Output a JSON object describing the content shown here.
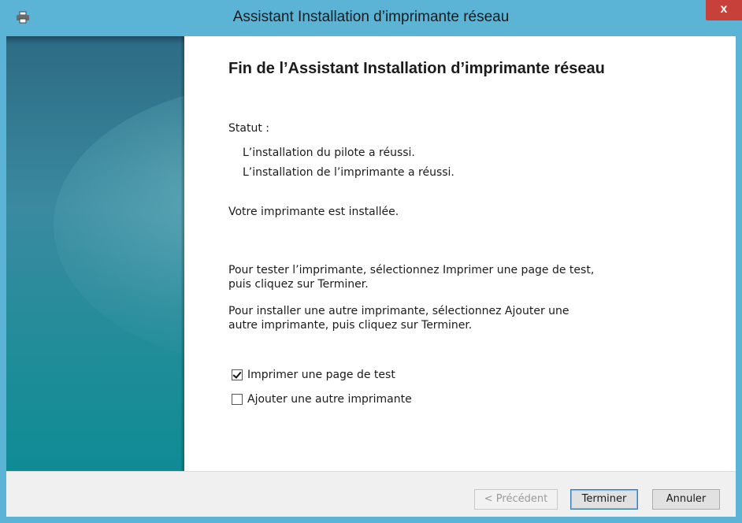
{
  "window": {
    "title": "Assistant Installation d’imprimante réseau",
    "close_label": "x",
    "title_icon": "printer-icon",
    "accent_color": "#5bb4d6",
    "close_color": "#c7413a"
  },
  "main": {
    "heading": "Fin de l’Assistant Installation d’imprimante réseau",
    "status_label": "Statut :",
    "status_lines": [
      "L’installation du pilote a réussi.",
      "L’installation de l’imprimante a réussi."
    ],
    "installed_message": "Votre imprimante est installée.",
    "test_instructions": [
      "Pour tester l’imprimante, sélectionnez Imprimer une page de test,",
      "puis cliquez sur Terminer."
    ],
    "add_instructions": [
      "Pour installer une autre imprimante, sélectionnez Ajouter une",
      "autre imprimante, puis cliquez sur Terminer."
    ],
    "checkboxes": [
      {
        "label": "Imprimer une page de test",
        "checked": true
      },
      {
        "label": "Ajouter une autre imprimante",
        "checked": false
      }
    ]
  },
  "footer": {
    "back_label": "< Précédent",
    "finish_label": "Terminer",
    "cancel_label": "Annuler"
  }
}
